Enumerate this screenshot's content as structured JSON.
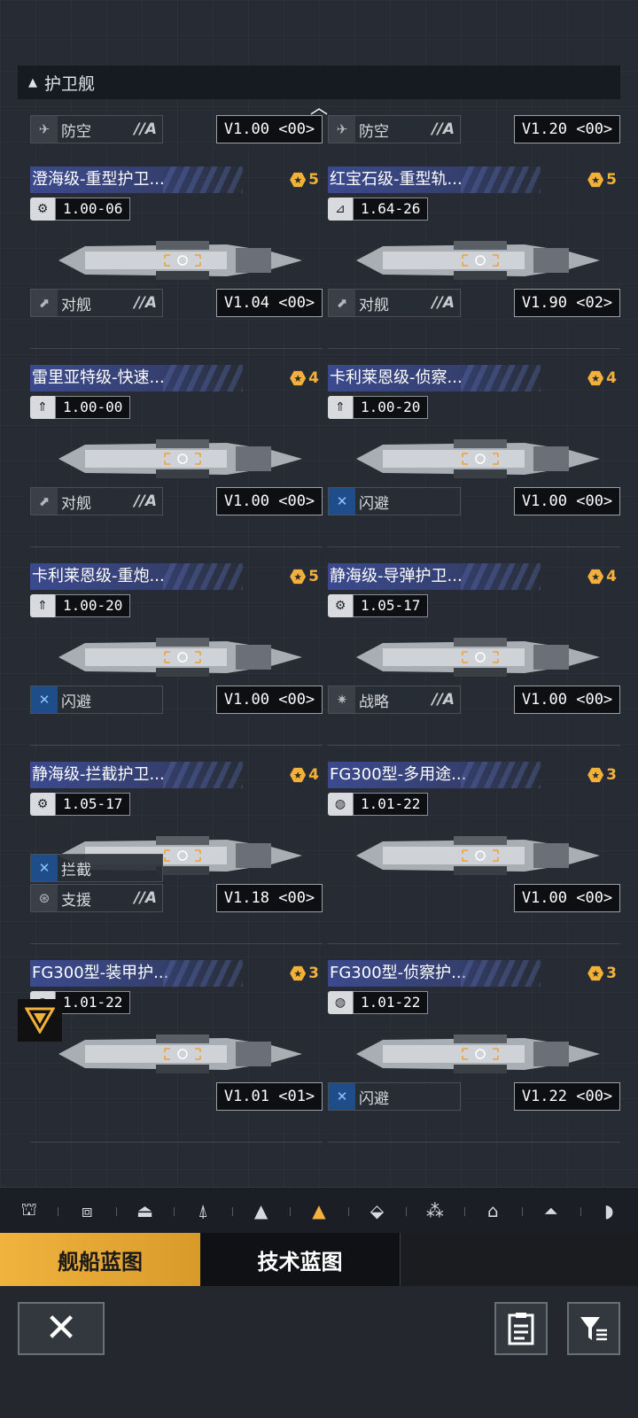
{
  "section_title": "护卫舰",
  "collapse_icon": "chevron-up-icon",
  "top_partial": [
    {
      "role": "防空",
      "grade": "//A",
      "code": "V1.00 <00>",
      "role_icon": "anti-air-icon"
    },
    {
      "role": "防空",
      "grade": "//A",
      "code": "V1.20 <00>",
      "role_icon": "anti-air-icon"
    }
  ],
  "cards": [
    {
      "name": "澄海级-重型护卫...",
      "stars": "5",
      "version": "1.00-06",
      "type_icon": "gear-icon",
      "roles": [
        {
          "label": "对舰",
          "grade": "//A",
          "blue": false,
          "icon": "anti-ship-icon"
        }
      ],
      "code": "V1.04 <00>"
    },
    {
      "name": "红宝石级-重型轨...",
      "stars": "5",
      "version": "1.64-26",
      "type_icon": "rail-icon",
      "roles": [
        {
          "label": "对舰",
          "grade": "//A",
          "blue": false,
          "icon": "anti-ship-icon"
        }
      ],
      "code": "V1.90 <02>"
    },
    {
      "name": "雷里亚特级-快速...",
      "stars": "4",
      "version": "1.00-00",
      "type_icon": "missile-icon",
      "roles": [
        {
          "label": "对舰",
          "grade": "//A",
          "blue": false,
          "icon": "anti-ship-icon"
        }
      ],
      "code": "V1.00 <00>"
    },
    {
      "name": "卡利莱恩级-侦察...",
      "stars": "4",
      "version": "1.00-20",
      "type_icon": "missile-icon",
      "roles": [
        {
          "label": "闪避",
          "grade": "",
          "blue": true,
          "icon": "evade-icon"
        }
      ],
      "code": "V1.00 <00>"
    },
    {
      "name": "卡利莱恩级-重炮...",
      "stars": "5",
      "version": "1.00-20",
      "type_icon": "missile-icon",
      "roles": [
        {
          "label": "闪避",
          "grade": "",
          "blue": true,
          "icon": "evade-icon"
        }
      ],
      "code": "V1.00 <00>"
    },
    {
      "name": "静海级-导弹护卫...",
      "stars": "4",
      "version": "1.05-17",
      "type_icon": "gear-icon",
      "roles": [
        {
          "label": "战略",
          "grade": "//A",
          "blue": false,
          "icon": "strategy-icon"
        }
      ],
      "code": "V1.00 <00>"
    },
    {
      "name": "静海级-拦截护卫...",
      "stars": "4",
      "version": "1.05-17",
      "type_icon": "gear-icon",
      "roles": [
        {
          "label": "拦截",
          "grade": "",
          "blue": true,
          "icon": "intercept-icon"
        },
        {
          "label": "支援",
          "grade": "//A",
          "blue": false,
          "icon": "support-icon"
        }
      ],
      "code": "V1.18 <00>"
    },
    {
      "name": "FG300型-多用途...",
      "stars": "3",
      "version": "1.01-22",
      "type_icon": "globe-icon",
      "roles": [],
      "code": "V1.00 <00>"
    },
    {
      "name": "FG300型-装甲护...",
      "stars": "3",
      "version": "1.01-22",
      "type_icon": "globe-icon",
      "roles": [],
      "code": "V1.01 <01>"
    },
    {
      "name": "FG300型-侦察护...",
      "stars": "3",
      "version": "1.01-22",
      "type_icon": "globe-icon",
      "roles": [
        {
          "label": "闪避",
          "grade": "",
          "blue": true,
          "icon": "evade-icon"
        }
      ],
      "code": "V1.22 <00>"
    }
  ],
  "toolbar_icons": [
    "station-icon",
    "carrier-icon",
    "battlecruiser-icon",
    "cruiser-icon",
    "destroyer-icon",
    "frigate-icon",
    "corvette-icon",
    "fighter-squad-icon",
    "outpost-icon",
    "dome-icon",
    "shelter-icon"
  ],
  "toolbar_active_index": 5,
  "tabs": {
    "ship_blueprint": "舰船蓝图",
    "tech_blueprint": "技术蓝图"
  },
  "bottom": {
    "close_icon": "close-icon",
    "notes_icon": "notes-icon",
    "filter_icon": "filter-icon"
  },
  "colors": {
    "accent": "#f0b33d",
    "name_bar": "#3b4a8e",
    "evade_blue": "#1f4d8a"
  }
}
